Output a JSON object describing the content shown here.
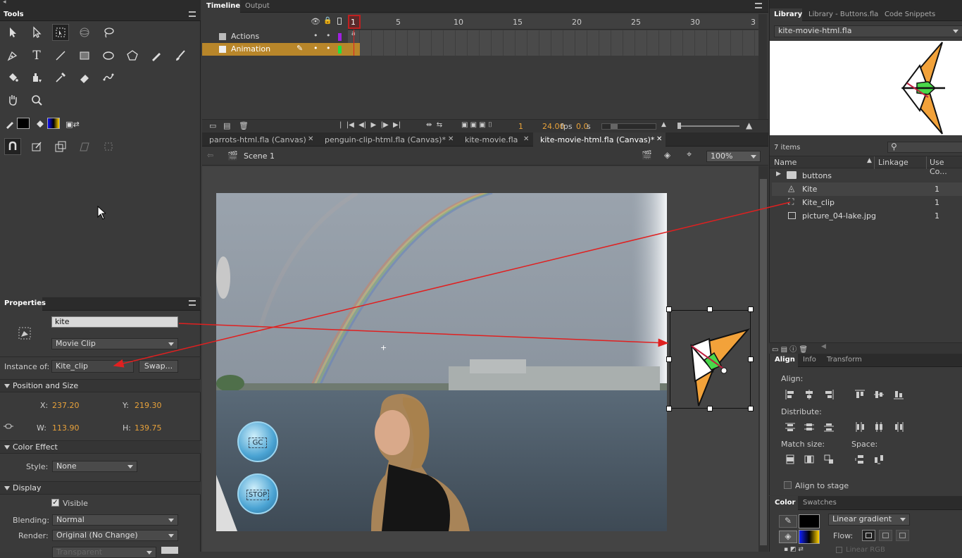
{
  "tools_panel": {
    "title": "Tools"
  },
  "timeline": {
    "tabs": [
      "Timeline",
      "Output"
    ],
    "frame_numbers": [
      "1",
      "5",
      "10",
      "15",
      "20",
      "25",
      "30",
      "3"
    ],
    "layers": [
      {
        "name": "Actions",
        "selected": false
      },
      {
        "name": "Animation",
        "selected": true
      }
    ],
    "current_frame": "1",
    "fps": "24.00",
    "fps_unit": "fps",
    "time": "0.0",
    "time_unit": "s"
  },
  "document_tabs": [
    {
      "label": "parrots-html.fla (Canvas)",
      "active": false
    },
    {
      "label": "penguin-clip-html.fla (Canvas)*",
      "active": false
    },
    {
      "label": "kite-movie.fla",
      "active": false
    },
    {
      "label": "kite-movie-html.fla (Canvas)*",
      "active": true
    }
  ],
  "edit_bar": {
    "scene": "Scene 1",
    "zoom": "100%"
  },
  "stage": {
    "buttons": [
      {
        "label": "GC"
      },
      {
        "label": "STOP"
      }
    ]
  },
  "properties": {
    "title": "Properties",
    "instance_name": "kite",
    "symbol_type": "Movie Clip",
    "instance_of_label": "Instance of:",
    "instance_of": "Kite_clip",
    "swap_label": "Swap...",
    "position_section": "Position and Size",
    "x_label": "X:",
    "x": "237.20",
    "y_label": "Y:",
    "y": "219.30",
    "w_label": "W:",
    "w": "113.90",
    "h_label": "H:",
    "h": "139.75",
    "color_effect_section": "Color Effect",
    "style_label": "Style:",
    "style": "None",
    "display_section": "Display",
    "visible_label": "Visible",
    "blending_label": "Blending:",
    "blending": "Normal",
    "render_label": "Render:",
    "render": "Original (No Change)",
    "transparent": "Transparent"
  },
  "library": {
    "tabs": [
      "Library",
      "Library - Buttons.fla",
      "Code Snippets"
    ],
    "document": "kite-movie-html.fla",
    "item_count": "7 items",
    "columns": [
      "Name",
      "Linkage",
      "Use Co..."
    ],
    "items": [
      {
        "name": "buttons",
        "count": "",
        "type": "folder"
      },
      {
        "name": "Kite",
        "count": "1",
        "type": "graphic"
      },
      {
        "name": "Kite_clip",
        "count": "1",
        "type": "movieclip"
      },
      {
        "name": "picture_04-lake.jpg",
        "count": "1",
        "type": "bitmap"
      }
    ]
  },
  "align_panel": {
    "tabs": [
      "Align",
      "Info",
      "Transform"
    ],
    "align_label": "Align:",
    "distribute_label": "Distribute:",
    "match_size_label": "Match size:",
    "space_label": "Space:",
    "align_to_stage": "Align to stage"
  },
  "color_panel": {
    "tabs": [
      "Color",
      "Swatches"
    ],
    "fill_type": "Linear gradient",
    "flow_label": "Flow:",
    "linear_rgb": "Linear RGB"
  },
  "colors": {
    "accent": "#e8a23a",
    "arrow": "#e02020",
    "selected_layer": "#b8862a"
  }
}
